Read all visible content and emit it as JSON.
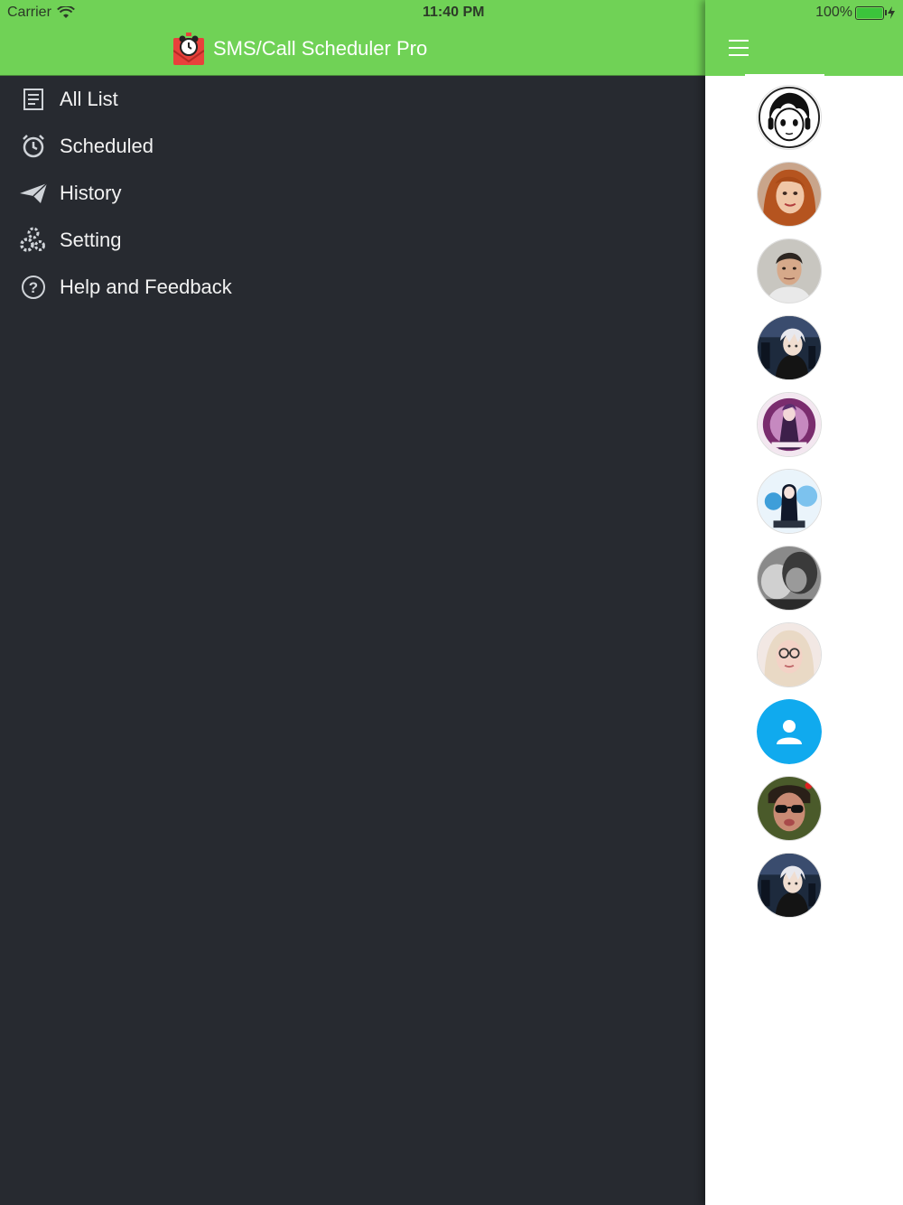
{
  "status_bar": {
    "carrier": "Carrier",
    "time": "11:40 PM",
    "battery": "100%"
  },
  "header": {
    "title": "SMS/Call Scheduler Pro",
    "logo_icon": "alarm-envelope-icon"
  },
  "menu": {
    "items": [
      {
        "label": "All List",
        "icon": "list-icon"
      },
      {
        "label": "Scheduled",
        "icon": "alarm-clock-icon"
      },
      {
        "label": "History",
        "icon": "paper-plane-icon"
      },
      {
        "label": "Setting",
        "icon": "gears-icon"
      },
      {
        "label": "Help and Feedback",
        "icon": "help-icon"
      }
    ]
  },
  "colors": {
    "header_green": "#70d256",
    "drawer_bg": "#272a30",
    "avatar_blue": "#10aaee"
  },
  "contacts": {
    "avatars": [
      "anime-line-avatar",
      "woman-red-hair-avatar",
      "man-avatar",
      "anime-white-hair-avatar",
      "anime-purple-avatar",
      "anime-blue-avatar",
      "bw-photo-avatar",
      "woman-glasses-avatar",
      "default-person-avatar",
      "man-sunglasses-avatar",
      "anime-white-hair-avatar-2"
    ]
  }
}
